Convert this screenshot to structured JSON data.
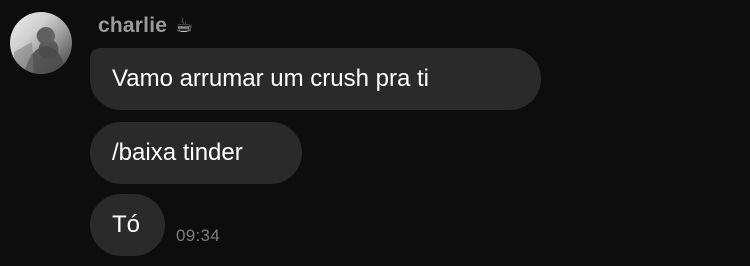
{
  "sender": {
    "name": "charlie",
    "emoji": "☕"
  },
  "messages": [
    {
      "text": "Vamo arrumar um crush pra ti"
    },
    {
      "text": "/baixa tinder"
    },
    {
      "text": "Tó"
    }
  ],
  "timestamp": "09:34",
  "colors": {
    "background": "#0d0d0d",
    "bubble": "#2a2a2a",
    "text": "#ffffff",
    "meta": "#9a9a9a"
  }
}
